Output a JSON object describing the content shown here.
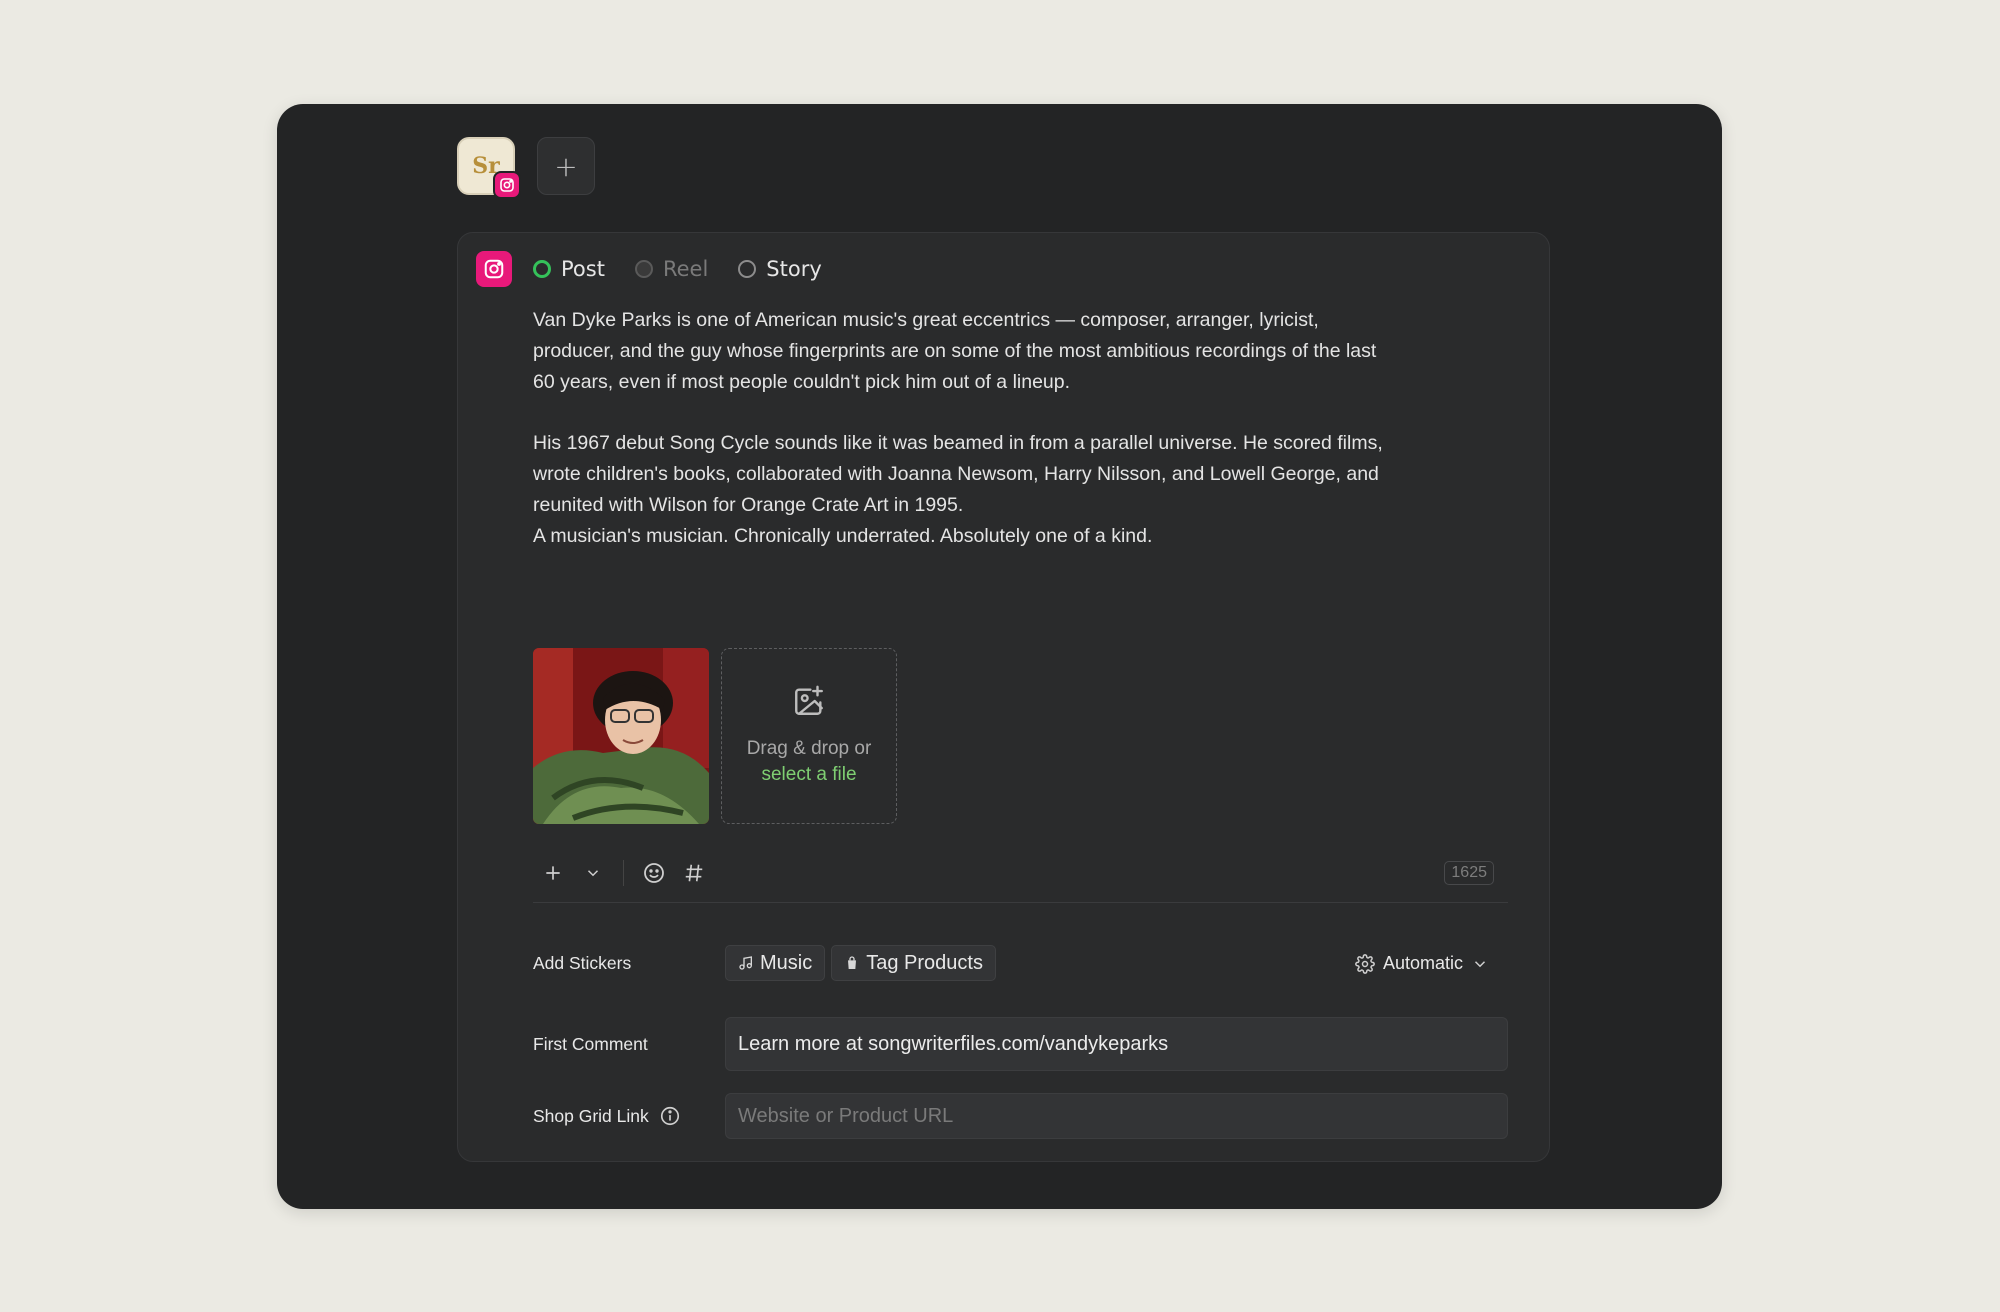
{
  "account": {
    "avatar_logo_text": "Sr",
    "add_account_label": "+"
  },
  "post_types": [
    {
      "label": "Post",
      "state": "checked"
    },
    {
      "label": "Reel",
      "state": "disabled"
    },
    {
      "label": "Story",
      "state": "unchecked"
    }
  ],
  "caption": "Van Dyke Parks is one of American music's great eccentrics — composer, arranger, lyricist,\nproducer, and the guy whose fingerprints are on some of the most ambitious recordings of the last\n60 years, even if most people couldn't pick him out of a lineup.\n\nHis 1967 debut Song Cycle sounds like it was beamed in from a parallel universe. He scored films,\nwrote children's books, collaborated with Joanna Newsom, Harry Nilsson, and Lowell George, and\nreunited with Wilson for Orange Crate Art in 1995.\nA musician's musician. Chronically underrated. Absolutely one of a kind.",
  "dropzone": {
    "text": "Drag & drop or",
    "link": "select a file"
  },
  "toolbar": {
    "char_count": "1625"
  },
  "stickers": {
    "label": "Add Stickers",
    "music": "Music",
    "tag_products": "Tag Products",
    "mode": "Automatic"
  },
  "first_comment": {
    "label": "First Comment",
    "value": "Learn more at songwriterfiles.com/vandykeparks"
  },
  "shop_grid": {
    "label": "Shop Grid Link",
    "placeholder": "Website or Product URL"
  },
  "colors": {
    "instagram": "#e8197a",
    "accent_green": "#35c15a",
    "link_green": "#7fcf72"
  }
}
